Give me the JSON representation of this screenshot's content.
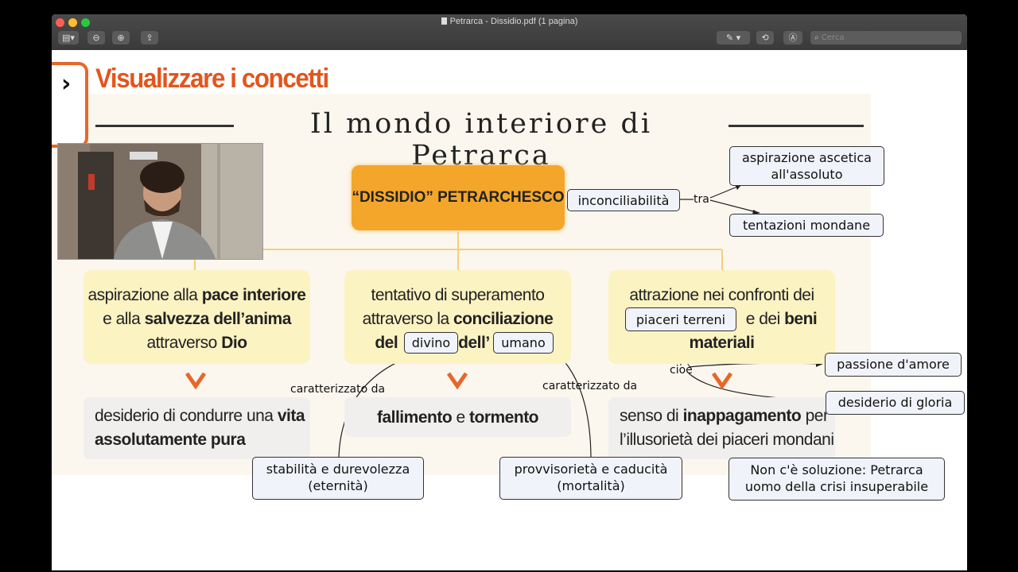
{
  "window": {
    "title": "Petrarca - Dissidio.pdf (1 pagina)",
    "search_placeholder": "Cerca",
    "icons": [
      "sidebar-toggle-icon",
      "zoom-out-icon",
      "zoom-in-icon",
      "share-icon",
      "markup-pen-icon",
      "rotate-icon",
      "annotate-icon",
      "search-icon"
    ]
  },
  "slide": {
    "heading": "Visualizzare i concetti",
    "subtitle": "Il mondo interiore di Petrarca",
    "center": "“DISSIDIO” PETRARCHESCO",
    "col1": {
      "text_parts": [
        "aspirazione alla ",
        "pace interiore",
        "e alla ",
        "salvezza dell’anima",
        "attraverso ",
        "Dio"
      ],
      "result_parts": [
        "desiderio di condurre una ",
        "vita",
        "assolutamente pura"
      ]
    },
    "col2": {
      "text_parts": [
        "tentativo di superamento",
        "attraverso la ",
        "conciliazione",
        "del",
        "dell’"
      ],
      "result_parts": [
        "fallimento",
        " e ",
        "tormento"
      ]
    },
    "col3": {
      "text_parts": [
        "attrazione nei confronti dei",
        "e dei ",
        "beni",
        "materiali"
      ],
      "result_parts": [
        "senso di ",
        "inappagamento",
        " per",
        "l’illusorietà dei piaceri mondani"
      ]
    },
    "accent_color": "#e2561d",
    "center_color": "#f4a62a"
  },
  "annotations": {
    "inconciliabilita": "inconciliabilità",
    "tra": "tra",
    "aspirazione_ascetica": "aspirazione ascetica all'assoluto",
    "tentazioni": "tentazioni mondane",
    "piaceri_terreni": "piaceri terreni",
    "divino": "divino",
    "umano": "umano",
    "cioe": "cioè",
    "passione": "passione d'amore",
    "desiderio_gloria": "desiderio di gloria",
    "caratterizzato_1": "caratterizzato da",
    "caratterizzato_2": "caratterizzato da",
    "stabilita_l1": "stabilità e durevolezza",
    "stabilita_l2": "(eternità)",
    "provvisorieta_l1": "provvisorietà e caducità",
    "provvisorieta_l2": "(mortalità)",
    "soluzione_l1": "Non c'è soluzione: Petrarca",
    "soluzione_l2": "uomo della crisi insuperabile"
  },
  "webcam": {
    "description_icon": "presenter-video"
  }
}
